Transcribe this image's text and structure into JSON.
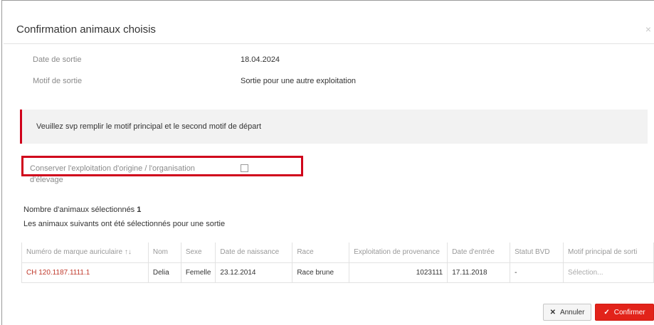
{
  "modal": {
    "title": "Confirmation animaux choisis",
    "close_symbol": "×"
  },
  "fields": {
    "date_label": "Date de sortie",
    "date_value": "18.04.2024",
    "motif_label": "Motif de sortie",
    "motif_value": "Sortie pour une autre exploitation"
  },
  "alert": {
    "message": "Veuillez svp remplir le motif principal et le second motif de départ",
    "accent_color": "#d0021b"
  },
  "checkbox": {
    "label": "Conserver l'exploitation d'origine / l'organisation d'élevage",
    "checked": false
  },
  "selection": {
    "count_label": "Nombre d'animaux sélectionnés",
    "count": "1",
    "subtitle": "Les animaux suivants ont été sélectionnés pour une sortie"
  },
  "table": {
    "headers": [
      "Numéro de marque auriculaire ↑↓",
      "Nom",
      "Sexe",
      "Date de naissance",
      "Race",
      "Exploitation de provenance",
      "Date d'entrée",
      "Statut BVD",
      "Motif principal de sorti"
    ],
    "rows": [
      [
        "CH 120.1187.1111.1",
        "Delia",
        "Femelle",
        "23.12.2014",
        "Race brune",
        "1023111",
        "17.11.2018",
        "-",
        "Sélection..."
      ]
    ]
  },
  "buttons": {
    "cancel_icon": "✕",
    "cancel": "Annuler",
    "confirm_icon": "✓",
    "confirm": "Confirmer"
  },
  "colors": {
    "primary": "#e2231a",
    "link": "#c0392b"
  }
}
